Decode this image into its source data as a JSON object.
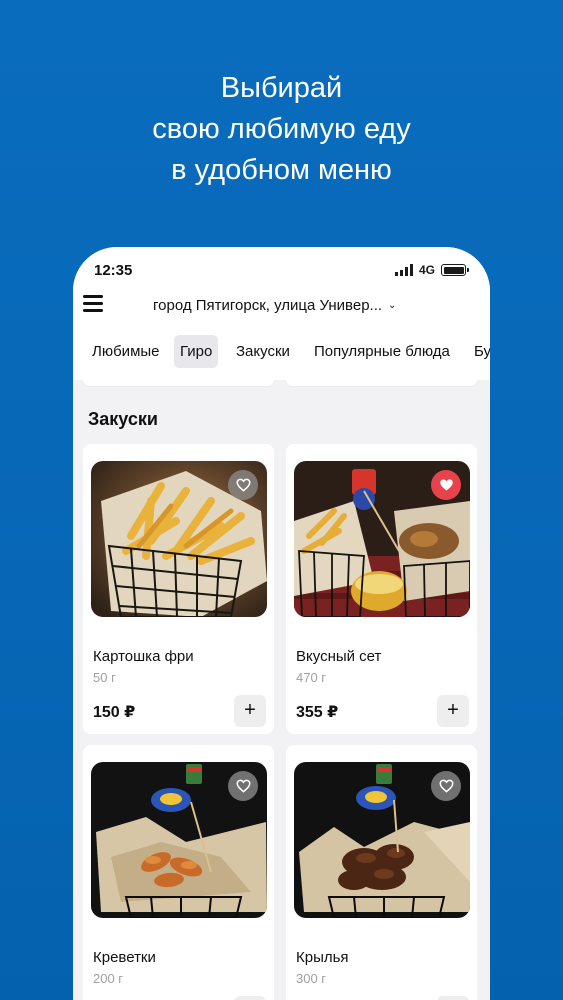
{
  "promo": {
    "line1": "Выбирай",
    "line2": "свою любимую еду",
    "line3": "в удобном меню"
  },
  "status": {
    "time": "12:35",
    "network": "4G"
  },
  "header": {
    "address": "город Пятигорск, улица Универ...",
    "menu_icon": "hamburger-icon",
    "dropdown_icon": "chevron-down-icon"
  },
  "tabs": [
    {
      "label": "Любимые"
    },
    {
      "label": "Гиро",
      "active": true
    },
    {
      "label": "Закуски"
    },
    {
      "label": "Популярные блюда"
    },
    {
      "label": "Бу"
    }
  ],
  "section": {
    "title": "Закуски"
  },
  "products": [
    {
      "name": "Картошка фри",
      "weight": "50 г",
      "price": "150 ₽",
      "favorite": false,
      "add_label": "+"
    },
    {
      "name": "Вкусный сет",
      "weight": "470 г",
      "price": "355 ₽",
      "favorite": true,
      "add_label": "+"
    },
    {
      "name": "Креветки",
      "weight": "200 г",
      "price": "",
      "favorite": false,
      "add_label": "+"
    },
    {
      "name": "Крылья",
      "weight": "300 г",
      "price": "",
      "favorite": false,
      "add_label": "+"
    }
  ],
  "colors": {
    "background": "#0767b6",
    "favorite_active": "#e8424c"
  }
}
